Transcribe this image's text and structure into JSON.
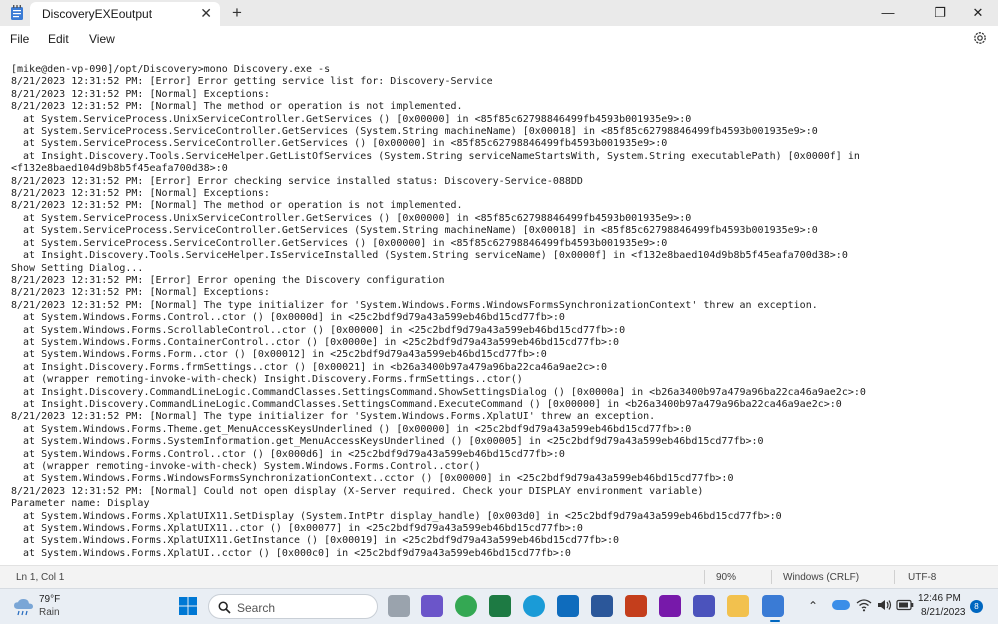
{
  "window": {
    "tab_title": "DiscoveryEXEoutput",
    "new_tab_symbol": "+",
    "close_tab_symbol": "✕",
    "controls": {
      "minimize": "—",
      "maximize": "❐",
      "close": "✕"
    }
  },
  "menu": [
    "File",
    "Edit",
    "View"
  ],
  "editor": {
    "lines": [
      "[mike@den-vp-090]/opt/Discovery>mono Discovery.exe -s",
      "8/21/2023 12:31:52 PM: [Error] Error getting service list for: Discovery-Service",
      "8/21/2023 12:31:52 PM: [Normal] Exceptions:",
      "8/21/2023 12:31:52 PM: [Normal] The method or operation is not implemented.",
      "  at System.ServiceProcess.UnixServiceController.GetServices () [0x00000] in <85f85c62798846499fb4593b001935e9>:0",
      "  at System.ServiceProcess.ServiceController.GetServices (System.String machineName) [0x00018] in <85f85c62798846499fb4593b001935e9>:0",
      "  at System.ServiceProcess.ServiceController.GetServices () [0x00000] in <85f85c62798846499fb4593b001935e9>:0",
      "  at Insight.Discovery.Tools.ServiceHelper.GetListOfServices (System.String serviceNameStartsWith, System.String executablePath) [0x0000f] in",
      "<f132e8baed104d9b8b5f45eafa700d38>:0",
      "8/21/2023 12:31:52 PM: [Error] Error checking service installed status: Discovery-Service-088DD",
      "8/21/2023 12:31:52 PM: [Normal] Exceptions:",
      "8/21/2023 12:31:52 PM: [Normal] The method or operation is not implemented.",
      "  at System.ServiceProcess.UnixServiceController.GetServices () [0x00000] in <85f85c62798846499fb4593b001935e9>:0",
      "  at System.ServiceProcess.ServiceController.GetServices (System.String machineName) [0x00018] in <85f85c62798846499fb4593b001935e9>:0",
      "  at System.ServiceProcess.ServiceController.GetServices () [0x00000] in <85f85c62798846499fb4593b001935e9>:0",
      "  at Insight.Discovery.Tools.ServiceHelper.IsServiceInstalled (System.String serviceName) [0x0000f] in <f132e8baed104d9b8b5f45eafa700d38>:0",
      "Show Setting Dialog...",
      "8/21/2023 12:31:52 PM: [Error] Error opening the Discovery configuration",
      "8/21/2023 12:31:52 PM: [Normal] Exceptions:",
      "8/21/2023 12:31:52 PM: [Normal] The type initializer for 'System.Windows.Forms.WindowsFormsSynchronizationContext' threw an exception.",
      "  at System.Windows.Forms.Control..ctor () [0x0000d] in <25c2bdf9d79a43a599eb46bd15cd77fb>:0",
      "  at System.Windows.Forms.ScrollableControl..ctor () [0x00000] in <25c2bdf9d79a43a599eb46bd15cd77fb>:0",
      "  at System.Windows.Forms.ContainerControl..ctor () [0x0000e] in <25c2bdf9d79a43a599eb46bd15cd77fb>:0",
      "  at System.Windows.Forms.Form..ctor () [0x00012] in <25c2bdf9d79a43a599eb46bd15cd77fb>:0",
      "  at Insight.Discovery.Forms.frmSettings..ctor () [0x00021] in <b26a3400b97a479a96ba22ca46a9ae2c>:0",
      "  at (wrapper remoting-invoke-with-check) Insight.Discovery.Forms.frmSettings..ctor()",
      "  at Insight.Discovery.CommandLineLogic.CommandClasses.SettingsCommand.ShowSettingsDialog () [0x0000a] in <b26a3400b97a479a96ba22ca46a9ae2c>:0",
      "  at Insight.Discovery.CommandLineLogic.CommandClasses.SettingsCommand.ExecuteCommand () [0x00000] in <b26a3400b97a479a96ba22ca46a9ae2c>:0",
      "8/21/2023 12:31:52 PM: [Normal] The type initializer for 'System.Windows.Forms.XplatUI' threw an exception.",
      "  at System.Windows.Forms.Theme.get_MenuAccessKeysUnderlined () [0x00000] in <25c2bdf9d79a43a599eb46bd15cd77fb>:0",
      "  at System.Windows.Forms.SystemInformation.get_MenuAccessKeysUnderlined () [0x00005] in <25c2bdf9d79a43a599eb46bd15cd77fb>:0",
      "  at System.Windows.Forms.Control..ctor () [0x000d6] in <25c2bdf9d79a43a599eb46bd15cd77fb>:0",
      "  at (wrapper remoting-invoke-with-check) System.Windows.Forms.Control..ctor()",
      "  at System.Windows.Forms.WindowsFormsSynchronizationContext..cctor () [0x00000] in <25c2bdf9d79a43a599eb46bd15cd77fb>:0",
      "8/21/2023 12:31:52 PM: [Normal] Could not open display (X-Server required. Check your DISPLAY environment variable)",
      "Parameter name: Display",
      "  at System.Windows.Forms.XplatUIX11.SetDisplay (System.IntPtr display_handle) [0x003d0] in <25c2bdf9d79a43a599eb46bd15cd77fb>:0",
      "  at System.Windows.Forms.XplatUIX11..ctor () [0x00077] in <25c2bdf9d79a43a599eb46bd15cd77fb>:0",
      "  at System.Windows.Forms.XplatUIX11.GetInstance () [0x00019] in <25c2bdf9d79a43a599eb46bd15cd77fb>:0",
      "  at System.Windows.Forms.XplatUI..cctor () [0x000c0] in <25c2bdf9d79a43a599eb46bd15cd77fb>:0"
    ]
  },
  "status": {
    "position": "Ln 1, Col 1",
    "zoom": "90%",
    "line_ending": "Windows (CRLF)",
    "encoding": "UTF-8"
  },
  "taskbar": {
    "weather_temp": "79°F",
    "weather_desc": "Rain",
    "search_placeholder": "Search",
    "time": "12:46 PM",
    "date": "8/21/2023",
    "notification_count": "8",
    "colors": {
      "start": "#0078d4",
      "accent": "#0067c0"
    }
  }
}
